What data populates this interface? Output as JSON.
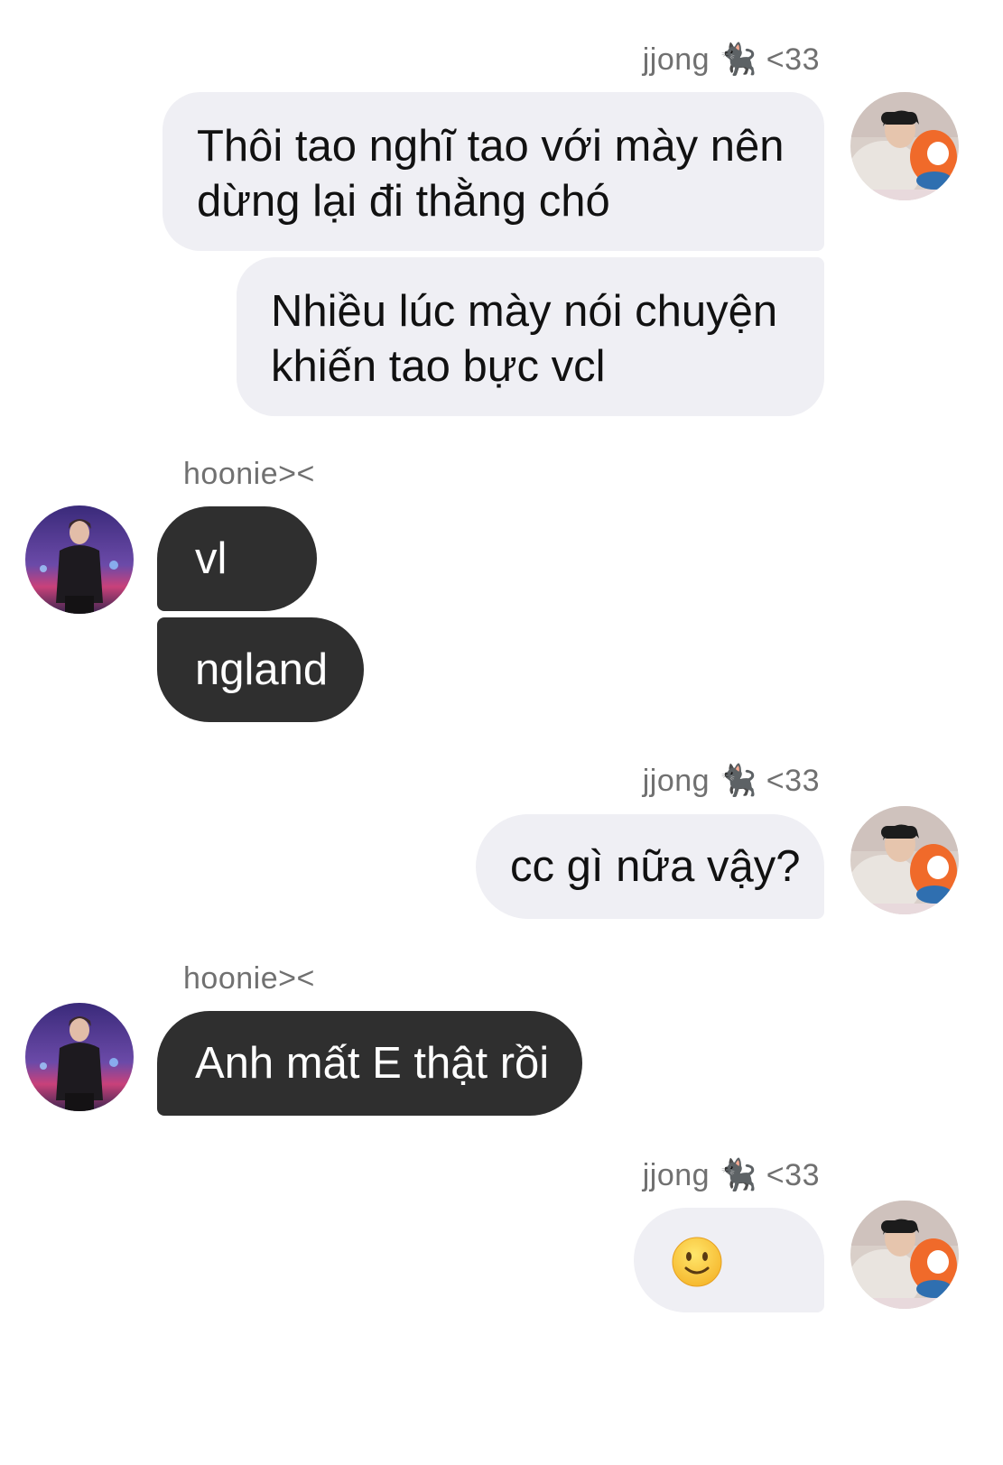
{
  "messages": [
    {
      "sender": "jjong 🐈‍⬛ <33",
      "side": "right",
      "bubbles": [
        "Thôi tao nghĩ tao với mày nên",
        "dừng lại đi thằng chó",
        "Nhiều lúc mày nói chuyện",
        "khiến tao bực vcl"
      ]
    },
    {
      "sender": "hoonie><",
      "side": "left",
      "bubbles": [
        "vl",
        "ngland"
      ]
    },
    {
      "sender": "jjong 🐈‍⬛ <33",
      "side": "right",
      "bubbles": [
        "cc gì nữa vậy?"
      ]
    },
    {
      "sender": "hoonie><",
      "side": "left",
      "bubbles": [
        "Anh mất E thật rồi"
      ]
    },
    {
      "sender": "jjong 🐈‍⬛ <33",
      "side": "right",
      "bubbles": [
        "slightly-smiling-face-emoji"
      ]
    }
  ],
  "colors": {
    "bubble_right_bg": "#efeff4",
    "bubble_left_bg": "#2f2f2f",
    "sender_text": "#707070"
  }
}
